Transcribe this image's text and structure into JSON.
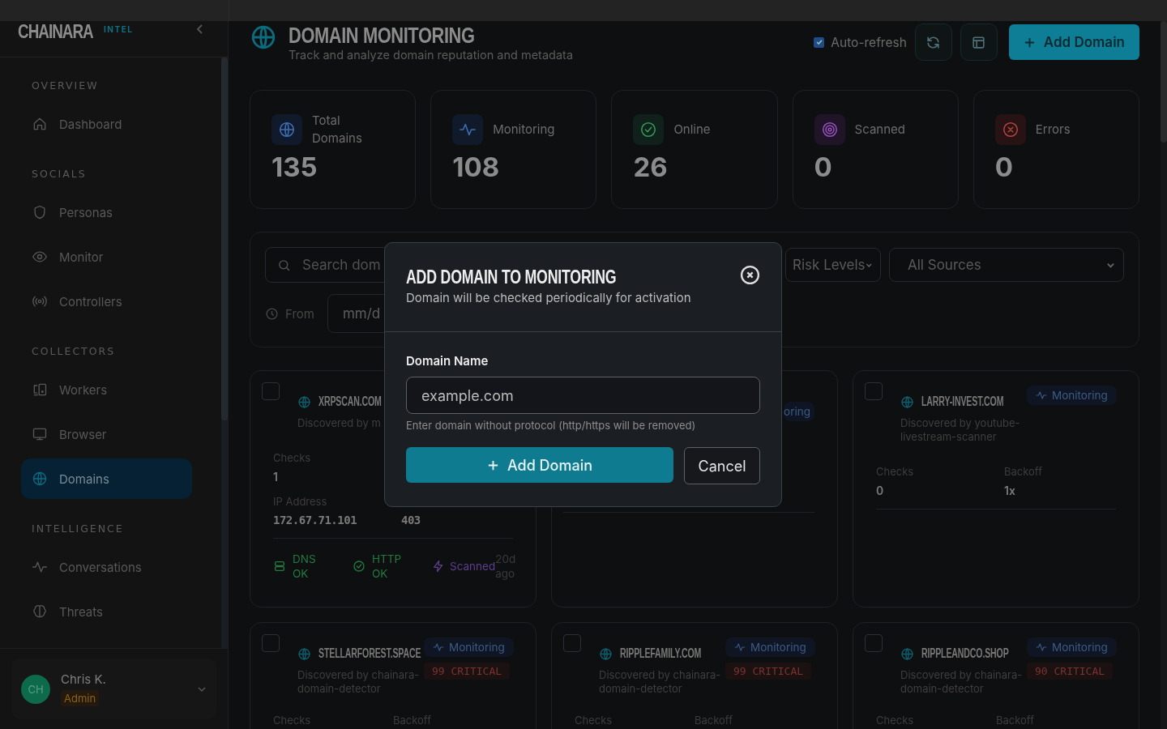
{
  "sidebar": {
    "brand": "CHAINARA",
    "brand_tag": "INTEL",
    "sections": [
      {
        "title": "OVERVIEW",
        "items": [
          {
            "label": "Dashboard",
            "selected": false
          }
        ]
      },
      {
        "title": "SOCIALS",
        "items": [
          {
            "label": "Personas",
            "selected": false
          },
          {
            "label": "Monitor",
            "selected": false
          },
          {
            "label": "Controllers",
            "selected": false
          }
        ]
      },
      {
        "title": "COLLECTORS",
        "items": [
          {
            "label": "Workers",
            "selected": false
          },
          {
            "label": "Browser",
            "selected": false
          },
          {
            "label": "Domains",
            "selected": true
          }
        ]
      },
      {
        "title": "INTELLIGENCE",
        "items": [
          {
            "label": "Conversations",
            "selected": false
          },
          {
            "label": "Threats",
            "selected": false
          }
        ]
      }
    ],
    "user": {
      "initials": "CH",
      "name": "Chris K.",
      "role": "Admin"
    }
  },
  "header": {
    "title": "DOMAIN MONITORING",
    "subtitle": "Track and analyze domain reputation and metadata",
    "auto_refresh": {
      "label": "Auto-refresh",
      "checked": true
    },
    "add_button": "Add Domain"
  },
  "stats": [
    {
      "label": "Total Domains",
      "value": "135",
      "kind": "total"
    },
    {
      "label": "Monitoring",
      "value": "108",
      "kind": "monitoring"
    },
    {
      "label": "Online",
      "value": "26",
      "kind": "online"
    },
    {
      "label": "Scanned",
      "value": "0",
      "kind": "scanned"
    },
    {
      "label": "Errors",
      "value": "0",
      "kind": "errors"
    }
  ],
  "filters": {
    "search_placeholder": "Search dom",
    "from_label": "From",
    "date_placeholder": "mm/d",
    "risk_select": "Risk Levels",
    "source_select": "All Sources"
  },
  "cards": [
    {
      "name": "XRPSCAN.COM",
      "discovered": "Discovered by m",
      "checked": false,
      "rows": [
        [
          {
            "label": "Checks",
            "value": "1"
          }
        ],
        [
          {
            "label": "IP Address",
            "value": "172.67.71.101"
          },
          {
            "value": "403"
          }
        ]
      ],
      "footer": [
        {
          "kind": "dns",
          "label": "DNS OK"
        },
        {
          "kind": "http",
          "label": "HTTP OK"
        },
        {
          "kind": "scanned",
          "label": "Scanned",
          "time": "20d ago"
        }
      ]
    },
    {
      "badge": "oring"
    },
    {
      "name": "LARRY-INVEST.COM",
      "discovered": "Discovered by youtube-livestream-scanner",
      "checked": false,
      "badge": "Monitoring",
      "rows": [
        [
          {
            "label": "Checks",
            "value": "0"
          },
          {
            "label": "Backoff",
            "value": "1x"
          }
        ]
      ]
    },
    {
      "name": "STELLARFOREST.SPACE",
      "discovered": "Discovered by chainara-domain-detector",
      "checked": false,
      "badge": "Monitoring",
      "risk": "99 CRITICAL",
      "labels": [
        "Checks",
        "Backoff"
      ]
    },
    {
      "name": "RIPPLEFAMILY.COM",
      "discovered": "Discovered by chainara-domain-detector",
      "checked": false,
      "badge": "Monitoring",
      "risk": "99 CRITICAL",
      "labels": [
        "Checks",
        "Backoff"
      ]
    },
    {
      "name": "RIPPLEANDCO.SHOP",
      "discovered": "Discovered by chainara-domain-detector",
      "checked": false,
      "badge": "Monitoring",
      "risk": "90 CRITICAL",
      "labels": [
        "Checks",
        "Backoff"
      ]
    }
  ],
  "modal": {
    "title": "ADD DOMAIN TO MONITORING",
    "subtitle": "Domain will be checked periodically for activation",
    "field_label": "Domain Name",
    "placeholder": "example.com",
    "hint": "Enter domain without protocol (http/https will be removed)",
    "submit": "Add Domain",
    "cancel": "Cancel"
  }
}
